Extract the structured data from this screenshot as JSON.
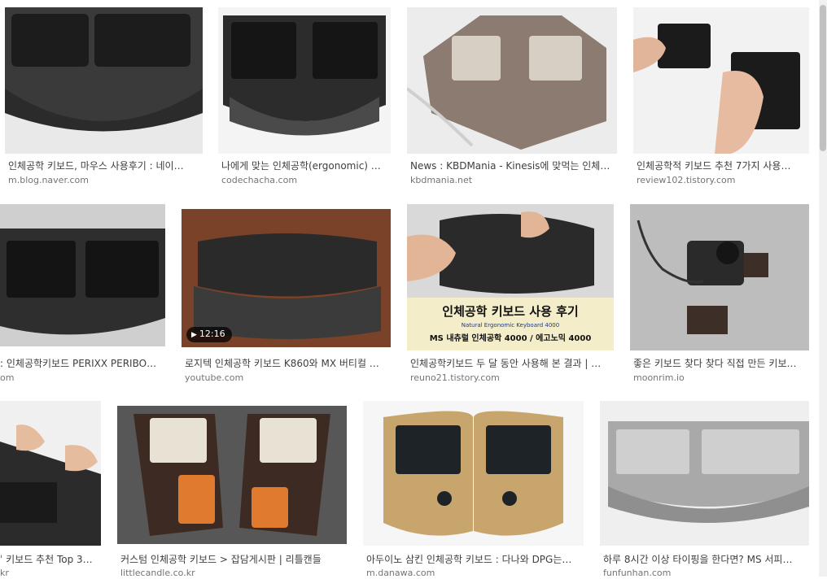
{
  "results": [
    {
      "caption": "인체공학 키보드, 마우스 사용후기 : 네이…",
      "source": "m.blog.naver.com"
    },
    {
      "caption": "나에게 맞는 인체공학(ergonomic) …",
      "source": "codechacha.com"
    },
    {
      "caption": "News : KBDMania - Kinesis에 맞먹는 인체공…",
      "source": "kbdmania.net"
    },
    {
      "caption": "인체공학적 키보드 추천 7가지 사용…",
      "source": "review102.tistory.com"
    },
    {
      "caption": ": 인체공학키보드 PERIXX PERIBO…",
      "source": "om"
    },
    {
      "caption": "로지텍 인체공학 키보드 K860와 MX 버티컬 …",
      "source": "youtube.com",
      "duration": "12:16"
    },
    {
      "caption": "인체공학키보드 두 달 동안 사용해 본 결과 | …",
      "source": "reuno21.tistory.com",
      "overlay": {
        "title": "인체공학 키보드 사용 후기",
        "sub": "Natural Ergonomic Keyboard 4000",
        "line": "MS 내츄럴 인체공학 4000 / 에고노믹 4000"
      }
    },
    {
      "caption": "좋은 키보드 찾다 찾다 직접 만든 키보…",
      "source": "moonrim.io"
    },
    {
      "caption": "ˈ 키보드 추천 Top 3…",
      "source": "kr"
    },
    {
      "caption": "커스텀 인체공학 키보드 > 잡담게시판 | 리틀캔들",
      "source": "littlecandle.co.kr"
    },
    {
      "caption": "아두이노 삼킨 인체공학 키보드 : 다나와 DPG는…",
      "source": "m.danawa.com"
    },
    {
      "caption": "하루 8시간 이상 타이핑을 한다면? MS 서피…",
      "source": "funfunhan.com"
    }
  ],
  "icons": {
    "play": "play-icon"
  },
  "colors": {
    "caption": "#3c4043",
    "source": "#70757a"
  }
}
